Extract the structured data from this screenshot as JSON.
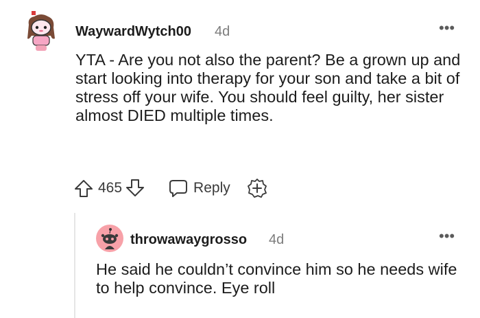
{
  "comment": {
    "author": "WaywardWytch00",
    "age": "4d",
    "body": "YTA - Are you not also the parent? Be a grown up and start looking into therapy for your son and take a bit of stress off your wife. You should feel guilty, her sister almost DIED multiple times.",
    "votes": "465",
    "reply_label": "Reply",
    "more_label": "•••"
  },
  "reply": {
    "author": "throwawaygrosso",
    "age": "4d",
    "body": "He said he couldn’t convince him so he needs wife to help convince. Eye roll",
    "more_label": "•••"
  },
  "colors": {
    "text": "#1c1c1c",
    "meta": "#7c7c7c",
    "reply_avatar_bg": "#f7a1a8",
    "avatar_primary_bg": "#fde3ea"
  },
  "icons": {
    "upvote": "upvote-arrow-icon",
    "downvote": "downvote-arrow-icon",
    "reply": "speech-bubble-icon",
    "award": "plus-circle-icon",
    "more": "ellipsis-icon"
  }
}
